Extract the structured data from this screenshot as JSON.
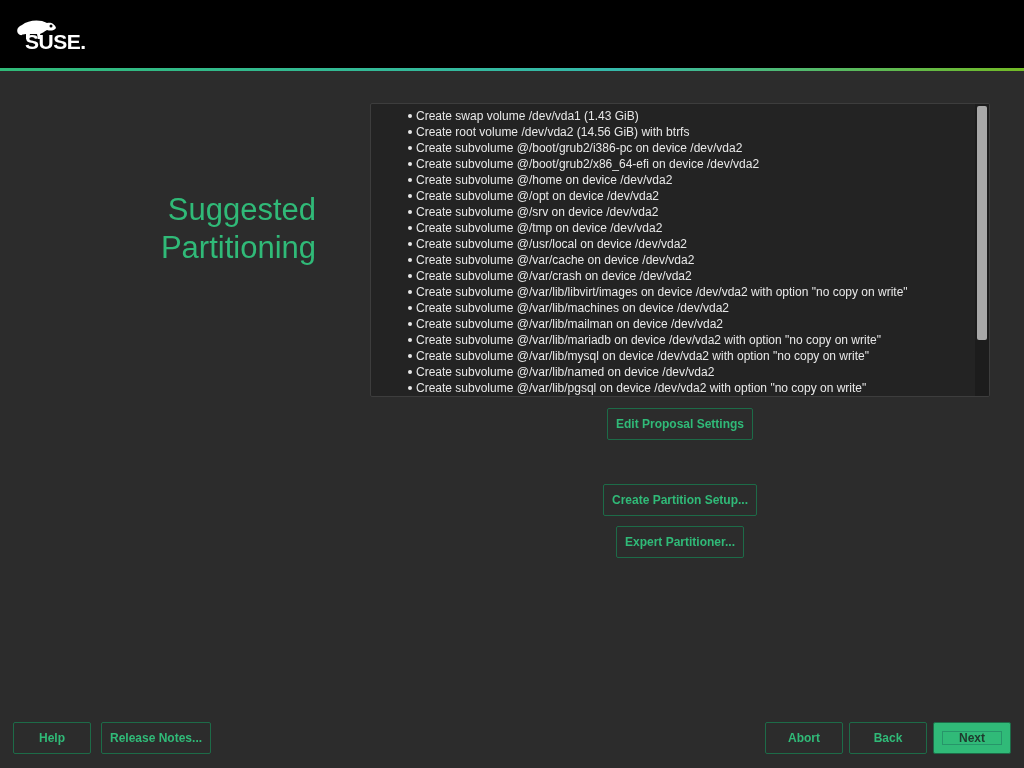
{
  "header": {
    "logo_text": "SUSE."
  },
  "title": {
    "lines": [
      "Suggested",
      "Partitioning"
    ]
  },
  "proposal": {
    "items": [
      "Create swap volume /dev/vda1 (1.43 GiB)",
      "Create root volume /dev/vda2 (14.56 GiB) with btrfs",
      "Create subvolume @/boot/grub2/i386-pc on device /dev/vda2",
      "Create subvolume @/boot/grub2/x86_64-efi on device /dev/vda2",
      "Create subvolume @/home on device /dev/vda2",
      "Create subvolume @/opt on device /dev/vda2",
      "Create subvolume @/srv on device /dev/vda2",
      "Create subvolume @/tmp on device /dev/vda2",
      "Create subvolume @/usr/local on device /dev/vda2",
      "Create subvolume @/var/cache on device /dev/vda2",
      "Create subvolume @/var/crash on device /dev/vda2",
      "Create subvolume @/var/lib/libvirt/images on device /dev/vda2 with option \"no copy on write\"",
      "Create subvolume @/var/lib/machines on device /dev/vda2",
      "Create subvolume @/var/lib/mailman on device /dev/vda2",
      "Create subvolume @/var/lib/mariadb on device /dev/vda2 with option \"no copy on write\"",
      "Create subvolume @/var/lib/mysql on device /dev/vda2 with option \"no copy on write\"",
      "Create subvolume @/var/lib/named on device /dev/vda2",
      "Create subvolume @/var/lib/pgsql on device /dev/vda2 with option \"no copy on write\""
    ]
  },
  "edit_button": "Edit Proposal Settings",
  "setup_buttons": [
    "Create Partition Setup...",
    "Expert Partitioner..."
  ],
  "footer": {
    "left_buttons": [
      {
        "label": "Help",
        "default": false
      },
      {
        "label": "Release Notes...",
        "default": false
      }
    ],
    "right_buttons": [
      {
        "label": "Abort",
        "default": false
      },
      {
        "label": "Back",
        "default": false
      },
      {
        "label": "Next",
        "default": true
      }
    ]
  }
}
